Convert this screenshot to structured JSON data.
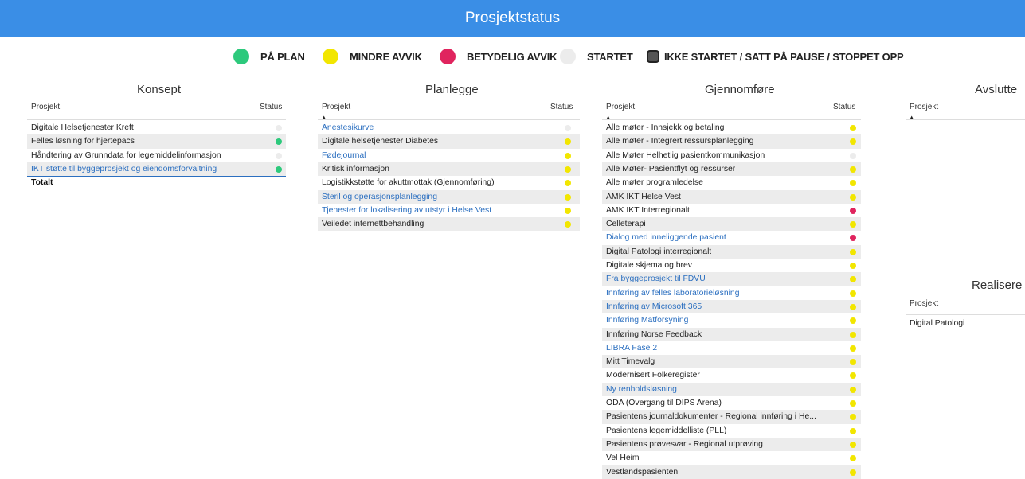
{
  "header": {
    "title": "Prosjektstatus"
  },
  "colors": {
    "green": "#2dc97c",
    "yellow": "#f2e600",
    "red": "#e0245e",
    "grey": "#ececec",
    "header": "#3a8ee6",
    "link": "#2b6fc0"
  },
  "legend": [
    {
      "label": "PÅ PLAN",
      "color": "#2dc97c",
      "icon": "green-dot-icon"
    },
    {
      "label": "MINDRE AVVIK",
      "color": "#f2e600",
      "icon": "yellow-dot-icon"
    },
    {
      "label": "BETYDELIG AVVIK",
      "color": "#e0245e",
      "icon": "red-dot-icon"
    },
    {
      "label": "STARTET",
      "color": "#ececec",
      "icon": "grey-dot-icon"
    },
    {
      "label": "IKKE STARTET / SATT PÅ PAUSE / STOPPET OPP",
      "color": "#555555",
      "icon": "stopped-icon"
    }
  ],
  "konsept": {
    "title": "Konsept",
    "col_project": "Prosjekt",
    "col_status": "Status",
    "rows": [
      {
        "name": "Digitale Helsetjenester Kreft",
        "status": "grey",
        "link": false
      },
      {
        "name": "Felles løsning for hjertepacs",
        "status": "green",
        "link": false
      },
      {
        "name": "Håndtering av Grunndata for legemiddelinformasjon",
        "status": "grey",
        "link": false
      },
      {
        "name": "IKT støtte til byggeprosjekt og eiendomsforvaltning",
        "status": "green",
        "link": true
      }
    ],
    "total": "Totalt"
  },
  "planlegge": {
    "title": "Planlegge",
    "col_project": "Prosjekt",
    "col_status": "Status",
    "rows": [
      {
        "name": "Anestesikurve",
        "status": "grey",
        "link": true
      },
      {
        "name": "Digitale helsetjenester Diabetes",
        "status": "yellow",
        "link": false
      },
      {
        "name": "Fødejournal",
        "status": "yellow",
        "link": true
      },
      {
        "name": "Kritisk informasjon",
        "status": "yellow",
        "link": false
      },
      {
        "name": "Logistikkstøtte for akuttmottak (Gjennomføring)",
        "status": "yellow",
        "link": false
      },
      {
        "name": "Steril og operasjonsplanlegging",
        "status": "yellow",
        "link": true
      },
      {
        "name": "Tjenester for lokalisering av utstyr i Helse Vest",
        "status": "yellow",
        "link": true
      },
      {
        "name": "Veiledet internettbehandling",
        "status": "yellow",
        "link": false
      }
    ]
  },
  "gjennomfore": {
    "title": "Gjennomføre",
    "col_project": "Prosjekt",
    "col_status": "Status",
    "rows": [
      {
        "name": "Alle møter - Innsjekk og betaling",
        "status": "yellow",
        "link": false
      },
      {
        "name": "Alle møter - Integrert ressursplanlegging",
        "status": "yellow",
        "link": false
      },
      {
        "name": "Alle Møter Helhetlig pasientkommunikasjon",
        "status": "grey",
        "link": false
      },
      {
        "name": "Alle Møter- Pasientflyt og ressurser",
        "status": "yellow",
        "link": false
      },
      {
        "name": "Alle møter programledelse",
        "status": "yellow",
        "link": false
      },
      {
        "name": "AMK IKT Helse Vest",
        "status": "yellow",
        "link": false
      },
      {
        "name": "AMK IKT Interregionalt",
        "status": "red",
        "link": false
      },
      {
        "name": "Celleterapi",
        "status": "yellow",
        "link": false
      },
      {
        "name": "Dialog med inneliggende pasient",
        "status": "red",
        "link": true
      },
      {
        "name": "Digital Patologi interregionalt",
        "status": "yellow",
        "link": false
      },
      {
        "name": "Digitale skjema og brev",
        "status": "yellow",
        "link": false
      },
      {
        "name": "Fra byggeprosjekt til FDVU",
        "status": "yellow",
        "link": true
      },
      {
        "name": "Innføring av felles laboratorieløsning",
        "status": "yellow",
        "link": true
      },
      {
        "name": "Innføring av Microsoft 365",
        "status": "yellow",
        "link": true
      },
      {
        "name": "Innføring Matforsyning",
        "status": "yellow",
        "link": true
      },
      {
        "name": "Innføring Norse Feedback",
        "status": "yellow",
        "link": false
      },
      {
        "name": "LIBRA Fase 2",
        "status": "yellow",
        "link": true
      },
      {
        "name": "Mitt Timevalg",
        "status": "yellow",
        "link": false
      },
      {
        "name": "Modernisert Folkeregister",
        "status": "yellow",
        "link": false
      },
      {
        "name": "Ny renholdsløsning",
        "status": "yellow",
        "link": true
      },
      {
        "name": "ODA (Overgang til DIPS Arena)",
        "status": "yellow",
        "link": false
      },
      {
        "name": "Pasientens journaldokumenter -  Regional innføring i He...",
        "status": "yellow",
        "link": false
      },
      {
        "name": "Pasientens legemiddelliste (PLL)",
        "status": "yellow",
        "link": false
      },
      {
        "name": "Pasientens prøvesvar - Regional utprøving",
        "status": "yellow",
        "link": false
      },
      {
        "name": "Vel Heim",
        "status": "yellow",
        "link": false
      },
      {
        "name": "Vestlandspasienten",
        "status": "yellow",
        "link": false
      }
    ]
  },
  "avslutte": {
    "title": "Avslutte",
    "col_project": "Prosjekt"
  },
  "realisere": {
    "title": "Realisere",
    "col_project": "Prosjekt",
    "rows": [
      {
        "name": "Digital Patologi"
      }
    ]
  }
}
